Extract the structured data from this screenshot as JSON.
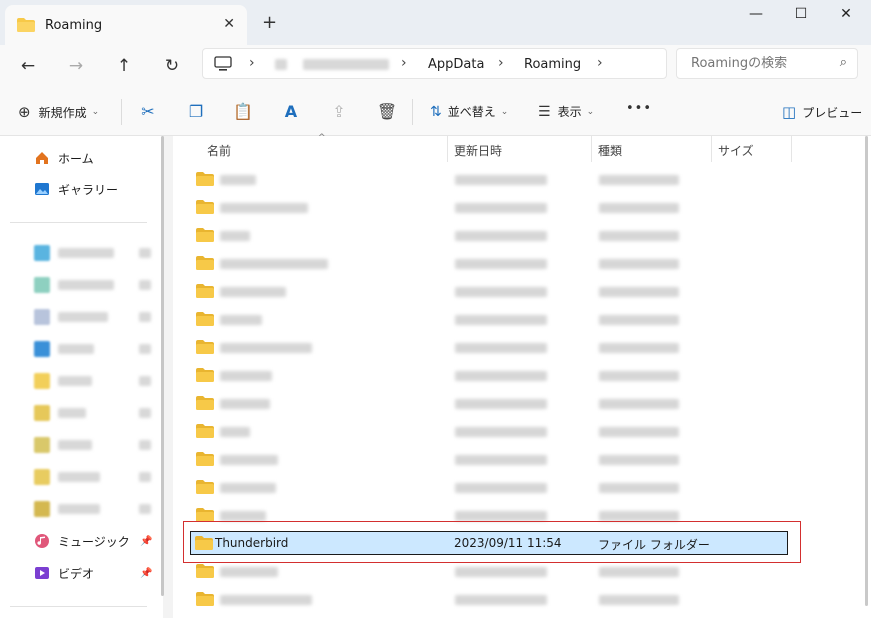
{
  "window": {
    "tab_title": "Roaming",
    "tab_close": "✕",
    "new_tab": "+",
    "minimize": "—",
    "maximize": "☐",
    "close": "✕"
  },
  "nav": {
    "back": "←",
    "forward": "→",
    "up": "↑",
    "refresh": "↻",
    "sep": "›",
    "crumbs": [
      "AppData",
      "Roaming"
    ],
    "search_placeholder": "Roamingの検索",
    "search_icon": "⌕"
  },
  "toolbar": {
    "new_label": "新規作成",
    "new_icon": "⊕",
    "cut_icon": "✂",
    "copy_icon": "❐",
    "paste_icon": "📋",
    "rename_icon": "A",
    "share_icon": "⇪",
    "delete_icon": "🗑",
    "sort_label": "並べ替え",
    "sort_icon": "⇅",
    "view_label": "表示",
    "view_icon": "☰",
    "more_label": "•••",
    "preview_label": "プレビュー",
    "preview_icon": "◫",
    "chev": "⌄"
  },
  "sidebar": {
    "home_label": "ホーム",
    "gallery_label": "ギャラリー",
    "music_label": "ミュージック",
    "video_label": "ビデオ",
    "pin_icon": "📌"
  },
  "columns": {
    "name": "名前",
    "modified": "更新日時",
    "type": "種類",
    "size": "サイズ",
    "sort_caret": "^"
  },
  "selected_row": {
    "name": "Thunderbird",
    "modified": "2023/09/11 11:54",
    "type": "ファイル フォルダー"
  },
  "colors": {
    "folder": "#f7c948",
    "selection": "#cce8ff",
    "highlight_outline": "#d32f2f"
  }
}
